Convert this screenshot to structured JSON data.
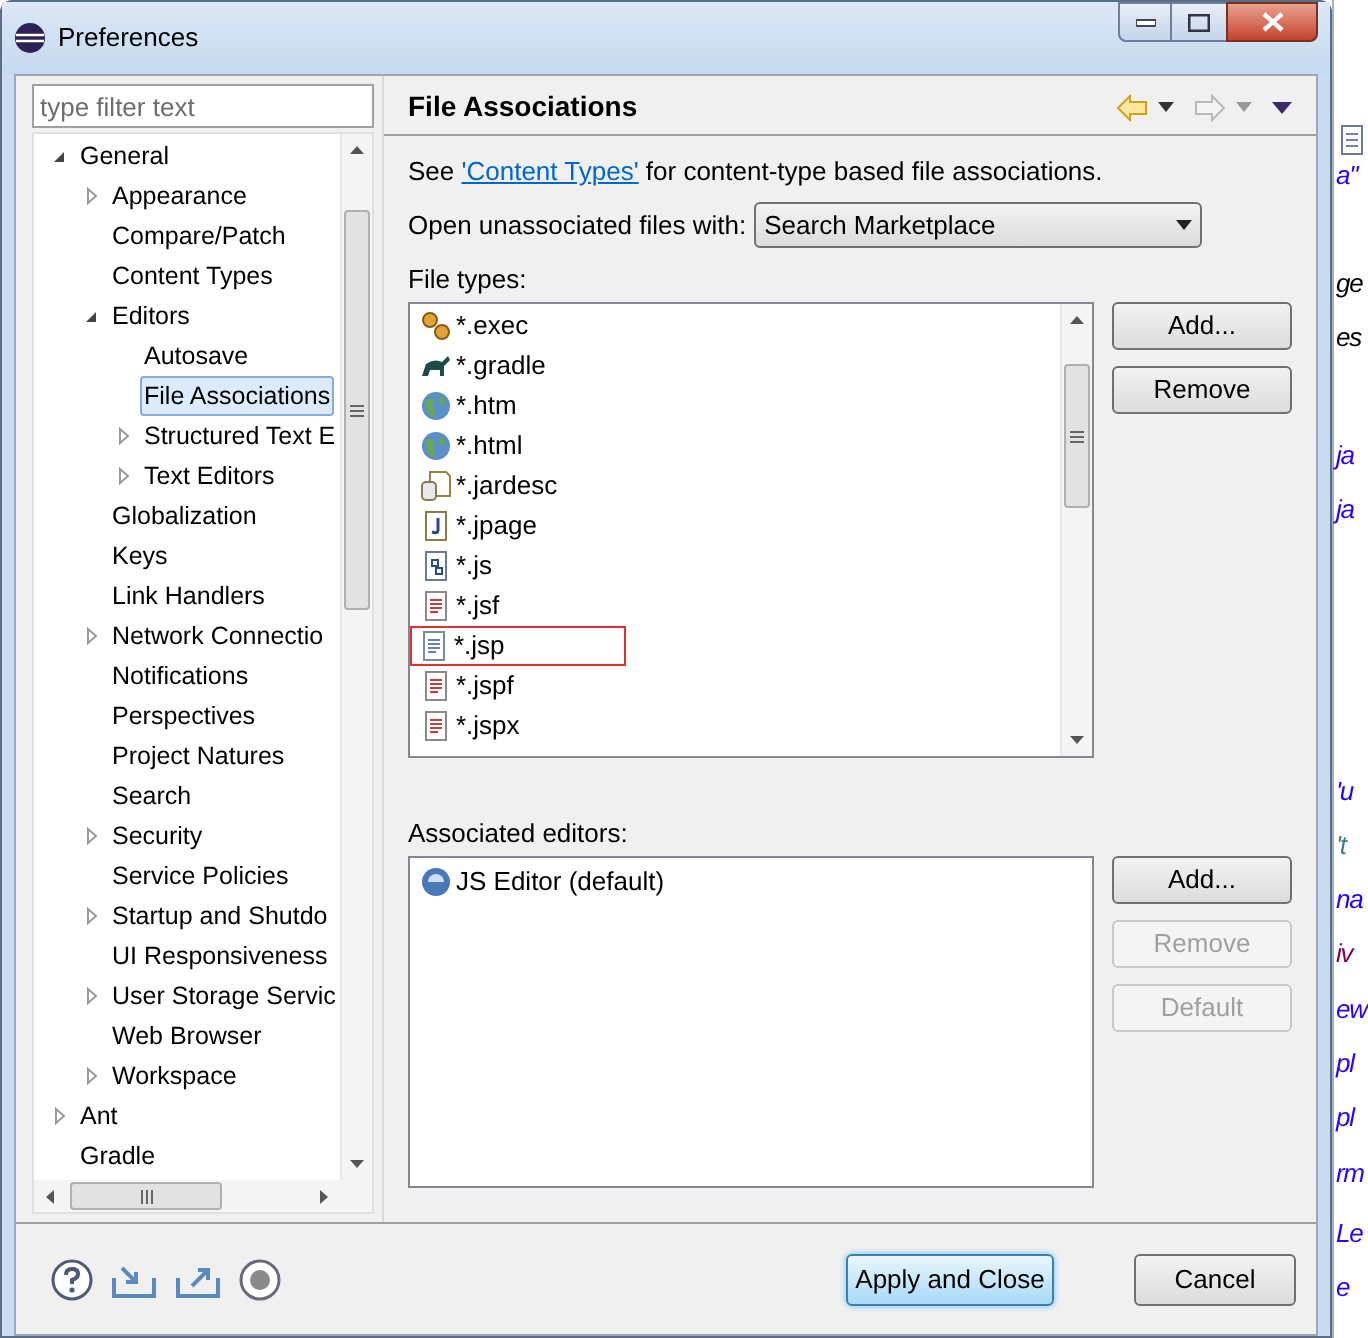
{
  "window": {
    "title": "Preferences"
  },
  "filter": {
    "placeholder": "type filter text"
  },
  "tree": [
    {
      "label": "General",
      "expanded": true,
      "selected": false,
      "children": [
        {
          "label": "Appearance",
          "expanded": false,
          "selected": false
        },
        {
          "label": "Compare/Patch",
          "selected": false
        },
        {
          "label": "Content Types",
          "selected": false
        },
        {
          "label": "Editors",
          "expanded": true,
          "selected": false,
          "children": [
            {
              "label": "Autosave",
              "selected": false
            },
            {
              "label": "File Associations",
              "selected": true
            },
            {
              "label": "Structured Text E",
              "expanded": false,
              "selected": false
            },
            {
              "label": "Text Editors",
              "expanded": false,
              "selected": false
            }
          ]
        },
        {
          "label": "Globalization",
          "selected": false
        },
        {
          "label": "Keys",
          "selected": false
        },
        {
          "label": "Link Handlers",
          "selected": false
        },
        {
          "label": "Network Connectio",
          "expanded": false,
          "selected": false
        },
        {
          "label": "Notifications",
          "selected": false
        },
        {
          "label": "Perspectives",
          "selected": false
        },
        {
          "label": "Project Natures",
          "selected": false
        },
        {
          "label": "Search",
          "selected": false
        },
        {
          "label": "Security",
          "expanded": false,
          "selected": false
        },
        {
          "label": "Service Policies",
          "selected": false
        },
        {
          "label": "Startup and Shutdo",
          "expanded": false,
          "selected": false
        },
        {
          "label": "UI Responsiveness",
          "selected": false
        },
        {
          "label": "User Storage Servic",
          "expanded": false,
          "selected": false
        },
        {
          "label": "Web Browser",
          "selected": false
        },
        {
          "label": "Workspace",
          "expanded": false,
          "selected": false
        }
      ]
    },
    {
      "label": "Ant",
      "expanded": false,
      "selected": false
    },
    {
      "label": "Gradle",
      "selected": false
    }
  ],
  "page": {
    "title": "File Associations",
    "intro_before": "See ",
    "intro_link": "'Content Types'",
    "intro_after": " for content-type based file associations.",
    "open_label": "Open unassociated files with:",
    "open_value": "Search Marketplace",
    "file_types_label": "File types:",
    "file_types": [
      {
        "name": "*.exec",
        "kind": "gears",
        "highlighted": false
      },
      {
        "name": "*.gradle",
        "kind": "elephant",
        "highlighted": false
      },
      {
        "name": "*.htm",
        "kind": "globe",
        "highlighted": false
      },
      {
        "name": "*.html",
        "kind": "globe",
        "highlighted": false
      },
      {
        "name": "*.jardesc",
        "kind": "jar",
        "highlighted": false
      },
      {
        "name": "*.jpage",
        "kind": "jpage",
        "highlighted": false
      },
      {
        "name": "*.js",
        "kind": "script",
        "highlighted": false
      },
      {
        "name": "*.jsf",
        "kind": "doc",
        "highlighted": false
      },
      {
        "name": "*.jsp",
        "kind": "plain",
        "highlighted": true
      },
      {
        "name": "*.jspf",
        "kind": "doc",
        "highlighted": false
      },
      {
        "name": "*.jspx",
        "kind": "doc",
        "highlighted": false
      }
    ],
    "file_type_buttons": [
      {
        "label": "Add...",
        "disabled": false
      },
      {
        "label": "Remove",
        "disabled": false
      }
    ],
    "editors_label": "Associated editors:",
    "editors": [
      {
        "name": "JS Editor (default)"
      }
    ],
    "editor_buttons": [
      {
        "label": "Add...",
        "disabled": false
      },
      {
        "label": "Remove",
        "disabled": true
      },
      {
        "label": "Default",
        "disabled": true
      }
    ]
  },
  "footer": {
    "buttons": [
      {
        "label": "Apply and Close",
        "default": true
      },
      {
        "label": "Cancel",
        "default": false
      }
    ]
  },
  "background_editor": [
    {
      "text": "a\"",
      "color": "#2a00ff"
    },
    {
      "text": "ge",
      "color": "#000000"
    },
    {
      "text": "es",
      "color": "#000000"
    },
    {
      "text": "ja",
      "color": "#2a00ff"
    },
    {
      "text": "ja",
      "color": "#2a00ff"
    },
    {
      "text": "'u",
      "color": "#2a00ff"
    },
    {
      "text": "'t",
      "color": "#3f7f7f"
    },
    {
      "text": "na",
      "color": "#2a00ff"
    },
    {
      "text": "iv",
      "color": "#7f0055"
    },
    {
      "text": "ew",
      "color": "#2a00ff"
    },
    {
      "text": "pl",
      "color": "#2a00ff"
    },
    {
      "text": "pl",
      "color": "#2a00ff"
    },
    {
      "text": "rm",
      "color": "#2a00ff"
    },
    {
      "text": "Le",
      "color": "#2a00ff"
    },
    {
      "text": "e",
      "color": "#2a00ff"
    }
  ]
}
